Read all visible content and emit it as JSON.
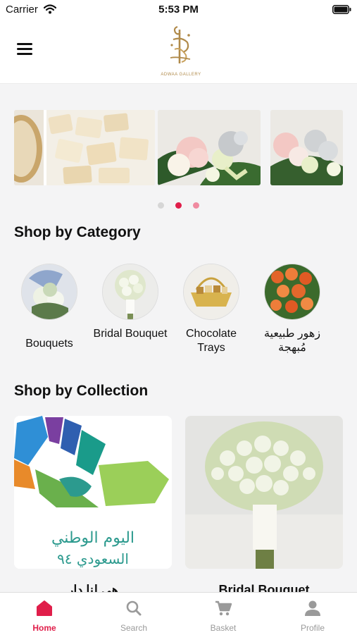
{
  "status_bar": {
    "carrier": "Carrier",
    "time": "5:53 PM"
  },
  "header": {
    "logo_text": "ADWAA GALLERY"
  },
  "carousel": {
    "slide_count": 3,
    "active_slide_index": 1,
    "active_dot_color": "#e01e4a",
    "inactive_dot_color": "#f08aa0"
  },
  "shop_by_category": {
    "title": "Shop by Category",
    "items": [
      {
        "label": "Bouquets"
      },
      {
        "label": "Bridal Bouquet"
      },
      {
        "label": "Chocolate Trays"
      },
      {
        "label": "زهور طبيعية مُبهجة"
      }
    ]
  },
  "shop_by_collection": {
    "title": "Shop by Collection",
    "items": [
      {
        "title": "هي لنا دار",
        "image_text_line1": "اليوم الوطني",
        "image_text_line2": "السعودي ٩٤"
      },
      {
        "title": "Bridal Bouquet"
      }
    ]
  },
  "tab_bar": {
    "active_color": "#e01e4a",
    "items": [
      {
        "label": "Home",
        "icon": "home-icon",
        "active": true
      },
      {
        "label": "Search",
        "icon": "search-icon",
        "active": false
      },
      {
        "label": "Basket",
        "icon": "basket-icon",
        "active": false
      },
      {
        "label": "Profile",
        "icon": "profile-icon",
        "active": false
      }
    ]
  }
}
